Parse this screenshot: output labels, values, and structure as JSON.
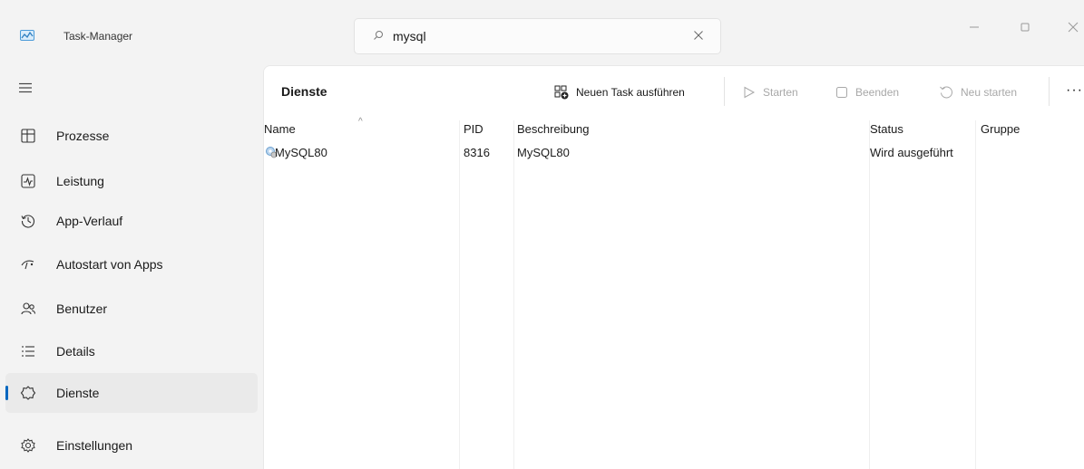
{
  "window": {
    "title": "Task-Manager",
    "icons": {
      "app": "task-manager-icon",
      "minimize": "minimize-icon",
      "maximize": "maximize-icon",
      "close": "close-icon"
    }
  },
  "search": {
    "value": "mysql",
    "placeholder": "",
    "icon": "search-icon",
    "clear_icon": "clear-icon"
  },
  "sidebar": {
    "menu_icon": "hamburger-icon",
    "items": [
      {
        "label": "Prozesse",
        "icon": "processes-icon"
      },
      {
        "label": "Leistung",
        "icon": "performance-icon"
      },
      {
        "label": "App-Verlauf",
        "icon": "history-icon"
      },
      {
        "label": "Autostart von Apps",
        "icon": "startup-icon"
      },
      {
        "label": "Benutzer",
        "icon": "users-icon"
      },
      {
        "label": "Details",
        "icon": "details-icon"
      },
      {
        "label": "Dienste",
        "icon": "services-icon",
        "active": true
      },
      {
        "label": "Einstellungen",
        "icon": "settings-icon"
      }
    ],
    "accent_color": "#0067c0"
  },
  "main": {
    "title": "Dienste",
    "toolbar": {
      "run_task": "Neuen Task ausführen",
      "start": "Starten",
      "stop": "Beenden",
      "restart": "Neu starten",
      "more": "···"
    },
    "columns": [
      "Name",
      "PID",
      "Beschreibung",
      "Status",
      "Gruppe"
    ],
    "rows": [
      {
        "name": "MySQL80",
        "pid": "8316",
        "description": "MySQL80",
        "status": "Wird ausgeführt",
        "group": ""
      }
    ]
  }
}
